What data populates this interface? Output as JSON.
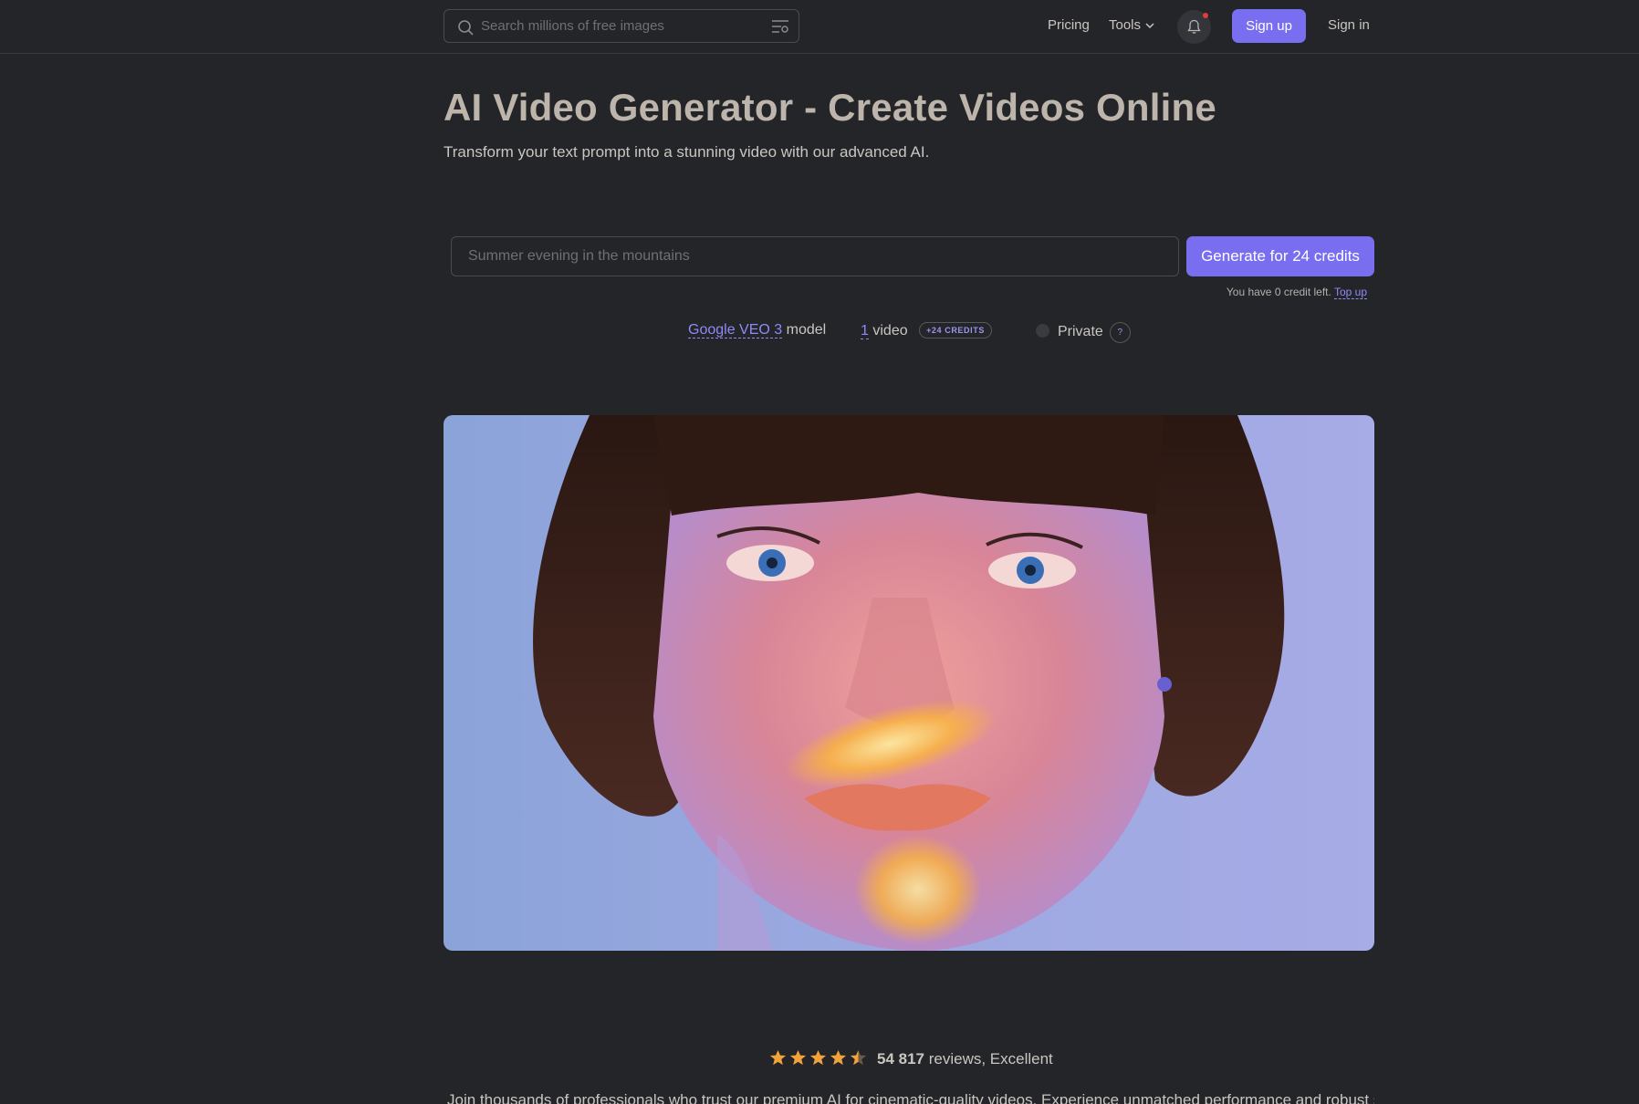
{
  "header": {
    "search": {
      "placeholder": "Search millions of free images",
      "icon": "search-icon"
    },
    "nav": {
      "pricing": "Pricing",
      "tools": "Tools"
    },
    "signup": "Sign up",
    "signin": "Sign in"
  },
  "hero": {
    "title": "AI Video Generator - Create Videos Online",
    "subtitle": "Transform your text prompt into a stunning video with our advanced AI."
  },
  "generator": {
    "prompt_placeholder": "Summer evening in the mountains",
    "generate_label": "Generate for 24 credits",
    "credits_text": "You have 0 credit left.",
    "topup": "Top up",
    "model_name": "Google VEO 3",
    "model_suffix": "model",
    "video_count": "1",
    "video_suffix": "video",
    "credits_badge": "+24 CREDITS",
    "private_label": "Private",
    "help": "?"
  },
  "reviews": {
    "rating_stars": 4.5,
    "count": "54 817",
    "text": "reviews, Excellent"
  },
  "join_text": "Join thousands of professionals who trust our premium AI for cinematic-quality videos. Experience unmatched performance and robust security",
  "colors": {
    "accent": "#7a6ef0",
    "background": "#242528",
    "star": "#f2a23a"
  }
}
